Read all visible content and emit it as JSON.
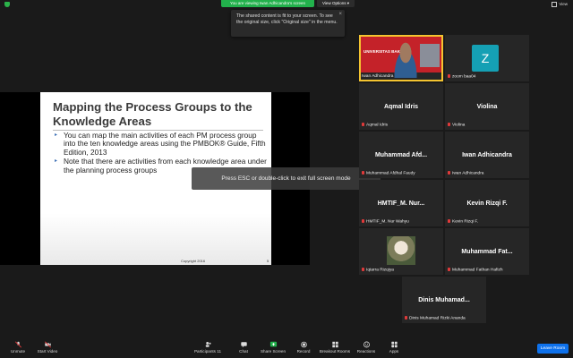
{
  "topbar": {
    "viewing_text": "You are viewing Iwan Adhicandra's screen",
    "view_options": "View Options ▾",
    "view": "View"
  },
  "tooltip": {
    "text": "The shared content is fit to your screen. To see the original size, click \"Original size\" in the menu."
  },
  "slide": {
    "title": "Mapping the Process Groups to the Knowledge Areas",
    "bullets": [
      "You can map the main activities of each PM process group into the ten knowledge areas using the PMBOK® Guide, Fifth Edition, 2013",
      "Note that there are activities from each knowledge area under the planning process groups"
    ],
    "copyright": "Copyright 2016",
    "page": "5"
  },
  "overlay": {
    "esc_text": "Press ESC or double-click to exit full screen mode"
  },
  "presenter": {
    "name": "Iwan Adhicandra",
    "brand": "UNIVERSITAS BAKRIE"
  },
  "participants": [
    {
      "center": "",
      "label": "zoom baa04"
    },
    {
      "center": "Aqmal Idris",
      "label": "Aqmal Idris"
    },
    {
      "center": "Violina",
      "label": "Violina"
    },
    {
      "center": "Muhammad Afd...",
      "label": "Muhammad Afdhal Faudy"
    },
    {
      "center": "Iwan Adhicandra",
      "label": "Iwan Adhicandra"
    },
    {
      "center": "HMTIF_M. Nur...",
      "label": "HMTIF_M. Nur Wahyu"
    },
    {
      "center": "Kevin Rizqi F.",
      "label": "Kevin Rizqi F."
    },
    {
      "center": "",
      "label": "Iqtarra Rizqiya"
    },
    {
      "center": "Muhammad Fat...",
      "label": "Muhammad Fathan Hafizh"
    },
    {
      "center": "Dinis Muhamad...",
      "label": "Dinis Muhamad Rizki Ananda"
    }
  ],
  "avatar_letter": "Z",
  "toolbar": {
    "unmute": "Unmute",
    "start_video": "Start Video",
    "participants": "Participants",
    "participants_count": "11",
    "chat": "Chat",
    "share_screen": "Share Screen",
    "record": "Record",
    "breakout_rooms": "Breakout Rooms",
    "reactions": "Reactions",
    "apps": "Apps",
    "leave": "Leave Room"
  },
  "colors": {
    "accent_green": "#22b14c",
    "leave_blue": "#0e71eb",
    "active_speaker": "#f4c430",
    "muted_red": "#e03a3a"
  }
}
